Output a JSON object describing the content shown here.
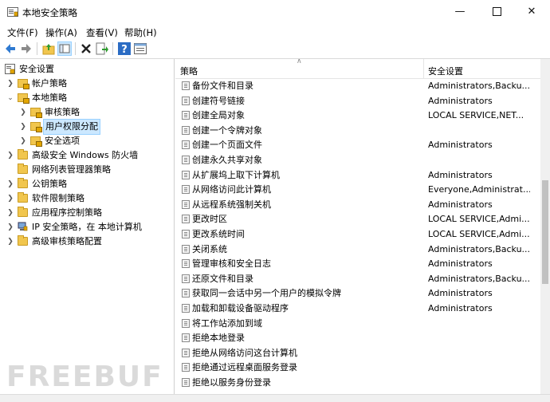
{
  "window": {
    "title": "本地安全策略",
    "controls": {
      "minimize": "—",
      "close": "✕"
    }
  },
  "menu": [
    "文件(F)",
    "操作(A)",
    "查看(V)",
    "帮助(H)"
  ],
  "toolbar_icons": [
    "back-arrow-icon",
    "forward-arrow-icon",
    "up-folder-icon",
    "show-hide-tree-icon",
    "delete-icon",
    "export-icon",
    "help-icon",
    "properties-icon"
  ],
  "tree": [
    {
      "label": "安全设置"
    },
    {
      "label": "帐户策略"
    },
    {
      "label": "本地策略"
    },
    {
      "label": "审核策略"
    },
    {
      "label": "用户权限分配"
    },
    {
      "label": "安全选项"
    },
    {
      "label": "高级安全 Windows 防火墙"
    },
    {
      "label": "网络列表管理器策略"
    },
    {
      "label": "公钥策略"
    },
    {
      "label": "软件限制策略"
    },
    {
      "label": "应用程序控制策略"
    },
    {
      "label": "IP 安全策略，在 本地计算机"
    },
    {
      "label": "高级审核策略配置"
    }
  ],
  "list": {
    "col_policy": "策略",
    "col_setting": "安全设置",
    "rows": [
      {
        "name": "备份文件和目录",
        "value": "Administrators,Backu..."
      },
      {
        "name": "创建符号链接",
        "value": "Administrators"
      },
      {
        "name": "创建全局对象",
        "value": "LOCAL SERVICE,NET..."
      },
      {
        "name": "创建一个令牌对象",
        "value": ""
      },
      {
        "name": "创建一个页面文件",
        "value": "Administrators"
      },
      {
        "name": "创建永久共享对象",
        "value": ""
      },
      {
        "name": "从扩展坞上取下计算机",
        "value": "Administrators"
      },
      {
        "name": "从网络访问此计算机",
        "value": "Everyone,Administrat..."
      },
      {
        "name": "从远程系统强制关机",
        "value": "Administrators"
      },
      {
        "name": "更改时区",
        "value": "LOCAL SERVICE,Admi..."
      },
      {
        "name": "更改系统时间",
        "value": "LOCAL SERVICE,Admi..."
      },
      {
        "name": "关闭系统",
        "value": "Administrators,Backu..."
      },
      {
        "name": "管理审核和安全日志",
        "value": "Administrators"
      },
      {
        "name": "还原文件和目录",
        "value": "Administrators,Backu..."
      },
      {
        "name": "获取同一会话中另一个用户的模拟令牌",
        "value": "Administrators"
      },
      {
        "name": "加载和卸载设备驱动程序",
        "value": "Administrators"
      },
      {
        "name": "将工作站添加到域",
        "value": ""
      },
      {
        "name": "拒绝本地登录",
        "value": ""
      },
      {
        "name": "拒绝从网络访问这台计算机",
        "value": ""
      },
      {
        "name": "拒绝通过远程桌面服务登录",
        "value": ""
      },
      {
        "name": "拒绝以服务身份登录",
        "value": ""
      }
    ]
  },
  "watermark": "FREEBUF",
  "colors": {
    "selection": "#cce8ff",
    "folder": "#f1c64e",
    "help": "#2b6cc4"
  }
}
